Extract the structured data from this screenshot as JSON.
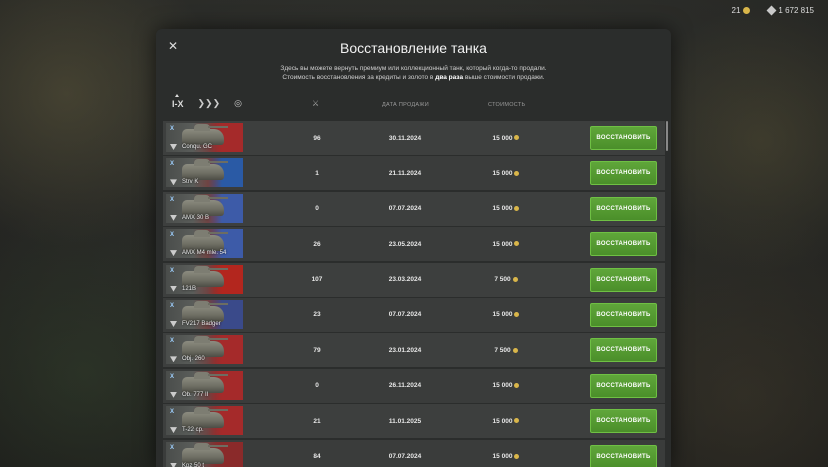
{
  "topbar": {
    "gold": "21",
    "credits": "1 672 815"
  },
  "modal": {
    "title": "Восстановление танка",
    "desc_line1": "Здесь вы можете вернуть премиум или коллекционный танк, который когда-то продали.",
    "desc_line2_a": "Стоимость восстановления за кредиты и золото в ",
    "desc_line2_b": "два раза",
    "desc_line2_c": " выше стоимости продажи.",
    "filters": {
      "tier": "I-X"
    },
    "columns": {
      "date": "ДАТА ПРОДАЖИ",
      "cost": "СТОИМОСТЬ"
    },
    "button_label": "ВОССТАНОВИТЬ"
  },
  "rows": [
    {
      "tier": "X",
      "name": "Conqu. GC",
      "battles": "96",
      "date": "30.11.2024",
      "cost": "15 000",
      "flag": "#a52a2a"
    },
    {
      "tier": "X",
      "name": "Strv K",
      "battles": "1",
      "date": "21.11.2024",
      "cost": "15 000",
      "flag": "#2a5aa5"
    },
    {
      "tier": "X",
      "name": "AMX 30 B",
      "battles": "0",
      "date": "07.07.2024",
      "cost": "15 000",
      "flag": "#3d5ba8"
    },
    {
      "tier": "X",
      "name": "AMX M4 mle. 54",
      "battles": "26",
      "date": "23.05.2024",
      "cost": "15 000",
      "flag": "#3d5ba8"
    },
    {
      "tier": "X",
      "name": "121B",
      "battles": "107",
      "date": "23.03.2024",
      "cost": "7 500",
      "flag": "#b3261e"
    },
    {
      "tier": "X",
      "name": "FV217 Badger",
      "battles": "23",
      "date": "07.07.2024",
      "cost": "15 000",
      "flag": "#3a4a8a"
    },
    {
      "tier": "X",
      "name": "Obj. 260",
      "battles": "79",
      "date": "23.01.2024",
      "cost": "7 500",
      "flag": "#a52a2a"
    },
    {
      "tier": "X",
      "name": "Ob. 777 II",
      "battles": "0",
      "date": "26.11.2024",
      "cost": "15 000",
      "flag": "#a52a2a"
    },
    {
      "tier": "X",
      "name": "T-22 ср.",
      "battles": "21",
      "date": "11.01.2025",
      "cost": "15 000",
      "flag": "#a52a2a"
    },
    {
      "tier": "X",
      "name": "Kpz 50 t",
      "battles": "84",
      "date": "07.07.2024",
      "cost": "15 000",
      "flag": "#8a2a2a"
    }
  ]
}
